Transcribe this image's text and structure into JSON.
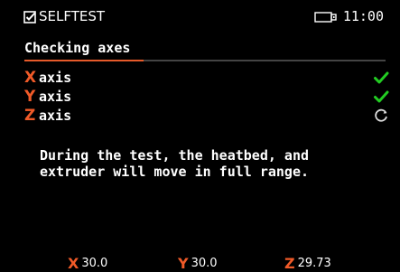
{
  "header": {
    "title": "SELFTEST",
    "time": "11:00",
    "title_icon": "checkbox-icon",
    "storage_icon": "usb-drive-icon"
  },
  "subtitle": "Checking axes",
  "progress": {
    "fraction": 0.33,
    "fill_color": "#e65a2a"
  },
  "axes": [
    {
      "letter": "X",
      "label": "axis",
      "status": "ok",
      "status_icon": "check-icon"
    },
    {
      "letter": "Y",
      "label": "axis",
      "status": "ok",
      "status_icon": "check-icon"
    },
    {
      "letter": "Z",
      "label": "axis",
      "status": "in-progress",
      "status_icon": "spinner-icon"
    }
  ],
  "info_text": "During the test, the heatbed, and\nextruder will move in full range.",
  "footer": {
    "x": {
      "letter": "X",
      "value": "30.0"
    },
    "y": {
      "letter": "Y",
      "value": "30.0"
    },
    "z": {
      "letter": "Z",
      "value": "29.73"
    }
  },
  "colors": {
    "accent": "#f05a28",
    "ok": "#22cc22",
    "background": "#000000",
    "text": "#ffffff"
  }
}
